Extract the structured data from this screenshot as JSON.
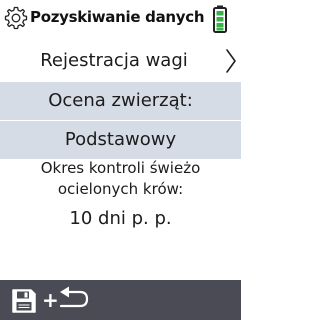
{
  "header": {
    "title": "Pozyskiwanie danych",
    "settings_icon": "gear-icon",
    "battery_icon": "battery-icon",
    "battery_color": "#37b34a"
  },
  "menu": {
    "label": "Rejestracja wagi",
    "nav_icon": "chevron-right-icon"
  },
  "selection": {
    "heading": "Ocena zwierząt:",
    "value": "Podstawowy",
    "band_color": "#d6dce6"
  },
  "info": {
    "line1": "Okres kontroli świeżo",
    "line2": "ocielonych krów:",
    "value": "10 dni p. p."
  },
  "footer": {
    "save_icon": "save-icon",
    "plus_text": "+",
    "back_icon": "back-arrow-icon",
    "background": "#4b4b55"
  }
}
